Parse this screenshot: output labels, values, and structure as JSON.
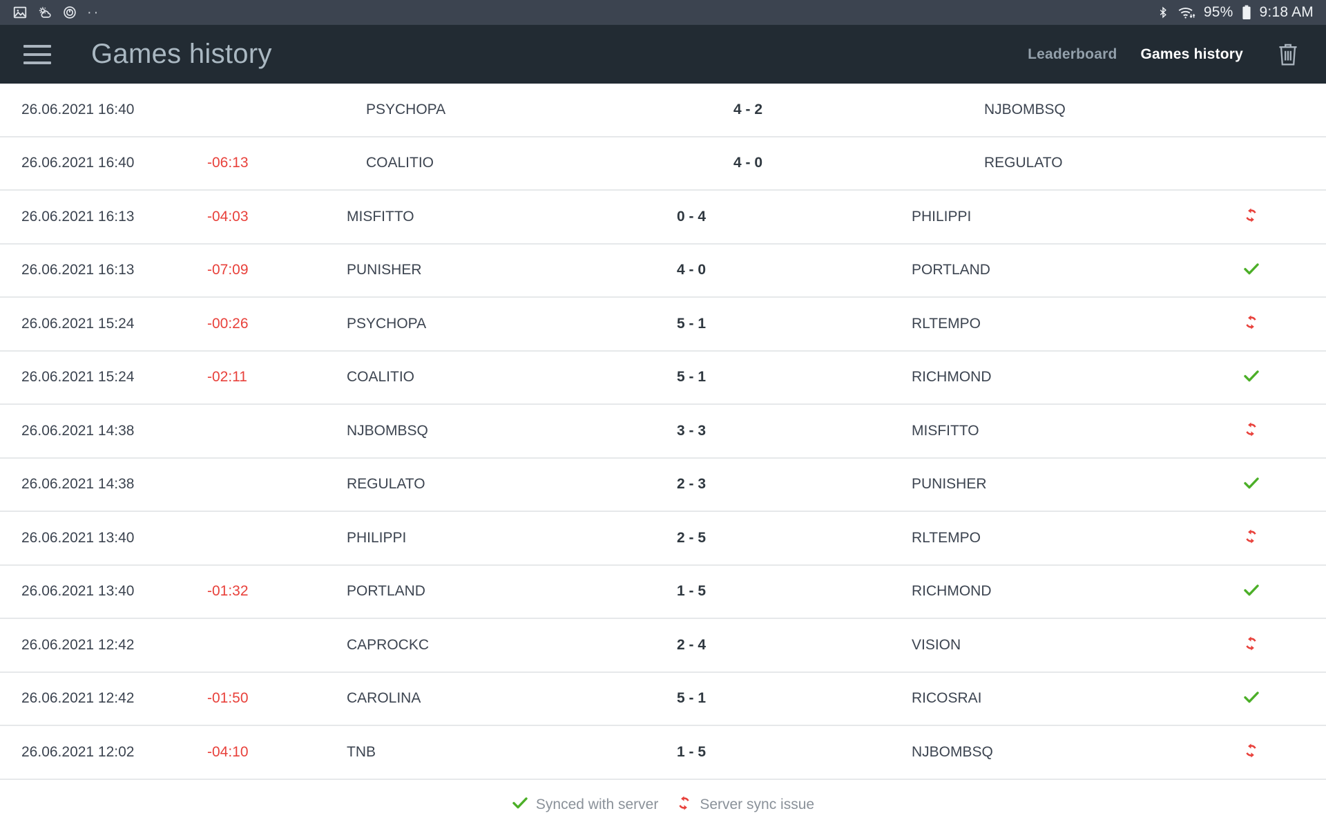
{
  "statusbar": {
    "left_icons": [
      "image-icon",
      "weather-icon",
      "alarm-icon"
    ],
    "overflow_dots": "··",
    "bluetooth_icon": "bluetooth-icon",
    "wifi_icon": "wifi-icon",
    "battery_percent": "95%",
    "battery_icon": "battery-icon",
    "time": "9:18 AM"
  },
  "appbar": {
    "menu_icon": "hamburger-menu-icon",
    "title": "Games history",
    "nav": [
      {
        "label": "Leaderboard",
        "active": false
      },
      {
        "label": "Games history",
        "active": true
      }
    ],
    "delete_icon": "trash-icon"
  },
  "colors": {
    "statusbar_bg": "#3c4450",
    "appbar_bg": "#222b33",
    "title": "#aab8c2",
    "offset_red": "#e8413b",
    "sync_ok_green": "#4caf28",
    "sync_error_red": "#e8413b",
    "row_border": "#e6e8ea",
    "text": "#3c4450"
  },
  "table": {
    "rows": [
      {
        "date": "26.06.2021 16:40",
        "offset": "",
        "home": "PSYCHOPA",
        "score": "4 - 2",
        "away": "NJBOMBSQ",
        "sync": "",
        "wide_indent": true
      },
      {
        "date": "26.06.2021 16:40",
        "offset": "-06:13",
        "home": "COALITIO",
        "score": "4 - 0",
        "away": "REGULATO",
        "sync": "",
        "wide_indent": true
      },
      {
        "date": "26.06.2021 16:13",
        "offset": "-04:03",
        "home": "MISFITTO",
        "score": "0 - 4",
        "away": "PHILIPPI",
        "sync": "error",
        "wide_indent": false
      },
      {
        "date": "26.06.2021 16:13",
        "offset": "-07:09",
        "home": "PUNISHER",
        "score": "4 - 0",
        "away": "PORTLAND",
        "sync": "ok",
        "wide_indent": false
      },
      {
        "date": "26.06.2021 15:24",
        "offset": "-00:26",
        "home": "PSYCHOPA",
        "score": "5 - 1",
        "away": "RLTEMPO",
        "sync": "error",
        "wide_indent": false
      },
      {
        "date": "26.06.2021 15:24",
        "offset": "-02:11",
        "home": "COALITIO",
        "score": "5 - 1",
        "away": "RICHMOND",
        "sync": "ok",
        "wide_indent": false
      },
      {
        "date": "26.06.2021 14:38",
        "offset": "",
        "home": "NJBOMBSQ",
        "score": "3 - 3",
        "away": "MISFITTO",
        "sync": "error",
        "wide_indent": false
      },
      {
        "date": "26.06.2021 14:38",
        "offset": "",
        "home": "REGULATO",
        "score": "2 - 3",
        "away": "PUNISHER",
        "sync": "ok",
        "wide_indent": false
      },
      {
        "date": "26.06.2021 13:40",
        "offset": "",
        "home": "PHILIPPI",
        "score": "2 - 5",
        "away": "RLTEMPO",
        "sync": "error",
        "wide_indent": false
      },
      {
        "date": "26.06.2021 13:40",
        "offset": "-01:32",
        "home": "PORTLAND",
        "score": "1 - 5",
        "away": "RICHMOND",
        "sync": "ok",
        "wide_indent": false
      },
      {
        "date": "26.06.2021 12:42",
        "offset": "",
        "home": "CAPROCKC",
        "score": "2 - 4",
        "away": "VISION",
        "sync": "error",
        "wide_indent": false
      },
      {
        "date": "26.06.2021 12:42",
        "offset": "-01:50",
        "home": "CAROLINA",
        "score": "5 - 1",
        "away": "RICOSRAI",
        "sync": "ok",
        "wide_indent": false
      },
      {
        "date": "26.06.2021 12:02",
        "offset": "-04:10",
        "home": "TNB",
        "score": "1 - 5",
        "away": "NJBOMBSQ",
        "sync": "error",
        "wide_indent": false
      }
    ]
  },
  "legend": {
    "synced_label": "Synced with server",
    "synced_icon": "check-icon",
    "issue_label": "Server sync issue",
    "issue_icon": "refresh-icon"
  }
}
